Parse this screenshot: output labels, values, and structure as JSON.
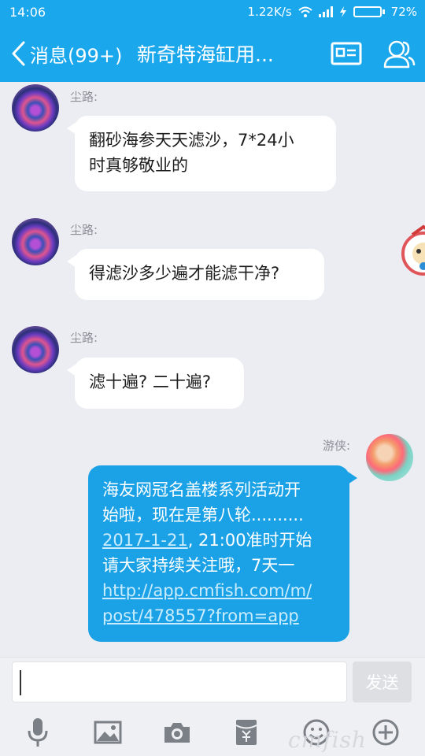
{
  "status_bar": {
    "time": "14:06",
    "network_speed": "1.22K/s",
    "battery_percent": "72%",
    "battery_level": 0.72,
    "charging_icon": "lightning-icon"
  },
  "header": {
    "back_label": "消息(99+)",
    "title": "新奇特海缸用...",
    "profile_icon": "profile-card-icon",
    "group_icon": "group-members-icon"
  },
  "messages": [
    {
      "sender": "尘路:",
      "side": "left",
      "lines": [
        "翻砂海参天天滤沙，7*24小",
        "时真够敬业的"
      ]
    },
    {
      "sender": "尘路:",
      "side": "left",
      "lines": [
        "得滤沙多少遍才能滤干净?"
      ]
    },
    {
      "sender": "尘路:",
      "side": "left",
      "lines": [
        "滤十遍? 二十遍?"
      ]
    },
    {
      "sender": "游侠:",
      "side": "right",
      "line1": "海友网冠名盖楼系列活动开",
      "line2": "始啦，现在是第八轮..........",
      "date_link": "2017-1-21",
      "line3_rest": ", 21:00准时开始",
      "line4": "请大家持续关注哦，7天一",
      "url_line1": "http://app.cmfish.com/m/",
      "url_line2": "post/478557?from=app"
    }
  ],
  "composer": {
    "input_value": "",
    "send_label": "发送"
  },
  "toolbar": {
    "items": [
      "microphone-icon",
      "image-icon",
      "camera-icon",
      "red-packet-icon",
      "emoji-icon",
      "plus-icon"
    ]
  },
  "watermark": "cmfish"
}
